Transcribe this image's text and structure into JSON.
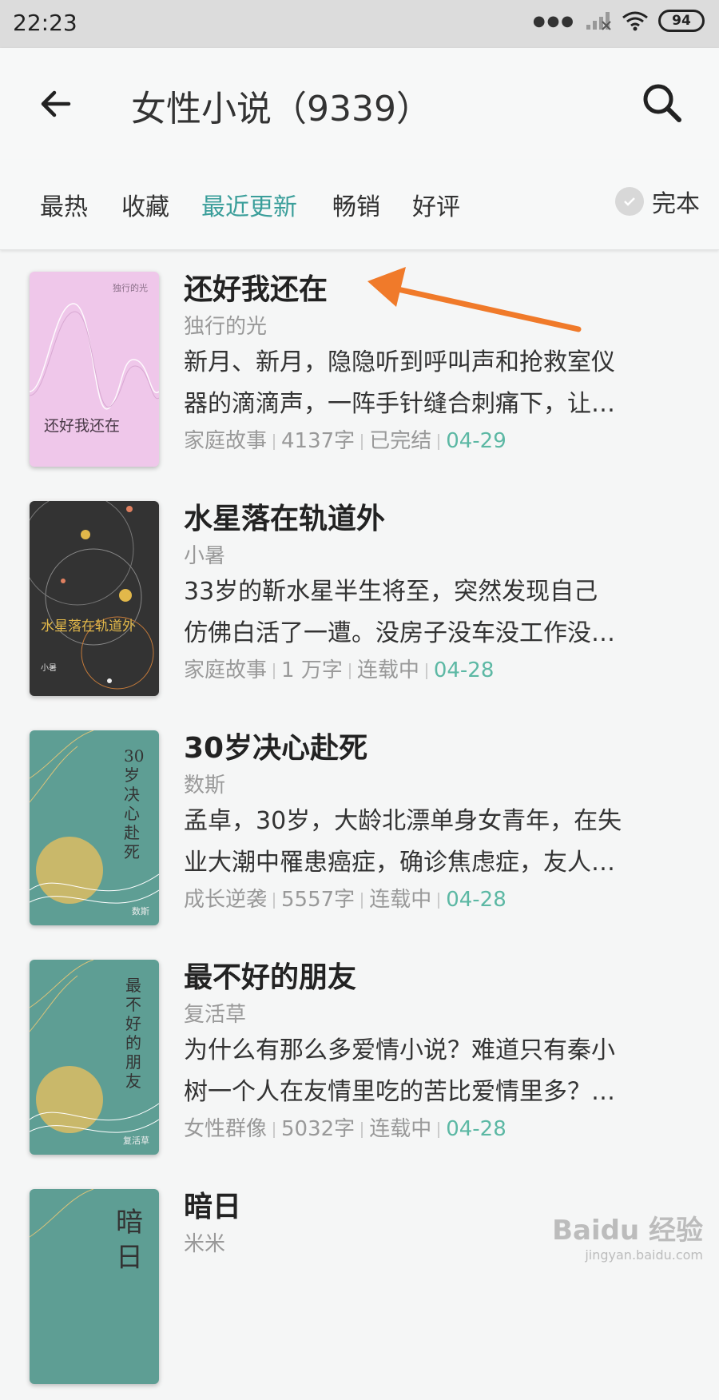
{
  "status": {
    "time": "22:23",
    "battery": "94"
  },
  "appbar": {
    "title": "女性小说（9339）"
  },
  "tabs": [
    {
      "label": "最热",
      "active": false
    },
    {
      "label": "收藏",
      "active": false
    },
    {
      "label": "最近更新",
      "active": true
    },
    {
      "label": "畅销",
      "active": false
    },
    {
      "label": "好评",
      "active": false
    }
  ],
  "filter": {
    "complete_label": "完本"
  },
  "books": [
    {
      "title": "还好我还在",
      "author": "独行的光",
      "desc_line1": "新月、新月，隐隐听到呼叫声和抢救室仪",
      "desc_line2": "器的滴滴声，一阵手针缝合刺痛下，让…",
      "category": "家庭故事",
      "words": "4137字",
      "status": "已完结",
      "date": "04-29",
      "cover_title": "还好我还在",
      "cover_author": "独行的光"
    },
    {
      "title": "水星落在轨道外",
      "author": "小暑",
      "desc_line1": "33岁的靳水星半生将至，突然发现自己",
      "desc_line2": "仿佛白活了一遭。没房子没车没工作没…",
      "category": "家庭故事",
      "words": "1 万字",
      "status": "连载中",
      "date": "04-28",
      "cover_title": "水星落在轨道外",
      "cover_author": "小暑"
    },
    {
      "title": "30岁决心赴死",
      "author": "数斯",
      "desc_line1": "孟卓，30岁，大龄北漂单身女青年，在失",
      "desc_line2": "业大潮中罹患癌症，确诊焦虑症，友人…",
      "category": "成长逆袭",
      "words": "5557字",
      "status": "连载中",
      "date": "04-28",
      "cover_title": "30岁决心赴死",
      "cover_author": "数斯"
    },
    {
      "title": "最不好的朋友",
      "author": "复活草",
      "desc_line1": "为什么有那么多爱情小说？难道只有秦小",
      "desc_line2": "树一个人在友情里吃的苦比爱情里多？…",
      "category": "女性群像",
      "words": "5032字",
      "status": "连载中",
      "date": "04-28",
      "cover_title": "最不好的朋友",
      "cover_author": "复活草"
    },
    {
      "title": "暗日",
      "author": "米米",
      "cover_title": "暗日"
    }
  ],
  "watermark": {
    "main": "Baidu 经验",
    "sub": "jingyan.baidu.com"
  },
  "colors": {
    "accent": "#3a9e9a",
    "date": "#5cb8a4",
    "arrow": "#f07a2a"
  }
}
